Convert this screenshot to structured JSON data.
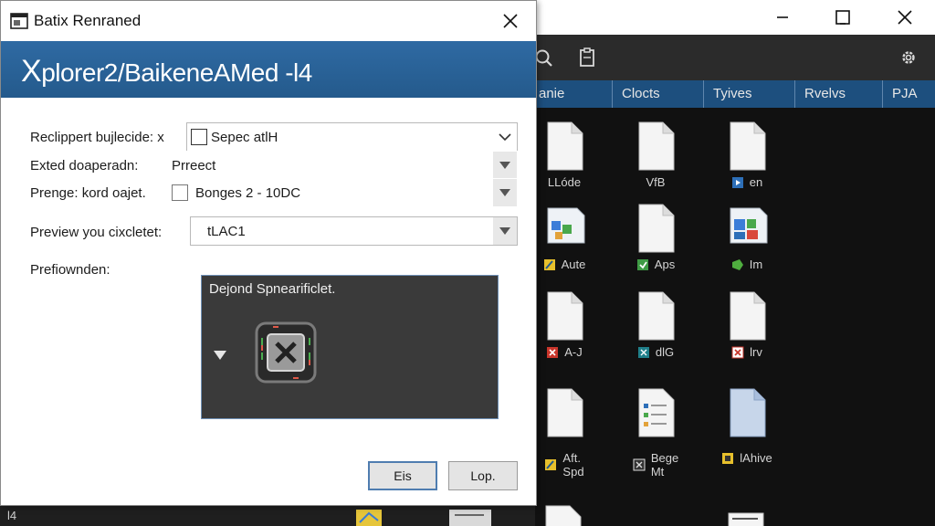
{
  "dialog": {
    "title": "Batix Renraned",
    "banner": {
      "prefix": "X",
      "rest": "plorer2/BaikeneAMed -l4"
    },
    "fields": [
      {
        "label": "Reclippert bujlecide: x",
        "value": "Sepec atlH",
        "checkbox": true,
        "control": "dropdown"
      },
      {
        "label": "Exted doaperadn:",
        "value": "Prreect",
        "checkbox": false,
        "control": "dropdown"
      },
      {
        "label": "Prenge: kord oajet.",
        "value": "Bonges 2 - 10DC",
        "checkbox": true,
        "control": "dropdown"
      },
      {
        "label": "Preview you cixcletet:",
        "value": "tLAC1",
        "checkbox": false,
        "control": "dropdown"
      }
    ],
    "preview": {
      "label": "Prefiownden:",
      "pane_title": "Dejond Spnearificlet."
    },
    "buttons": {
      "ok": "Eis",
      "cancel": "Lop."
    }
  },
  "explorer": {
    "window_controls": [
      "minimize-icon",
      "maximize-icon",
      "close-icon"
    ],
    "toolbar_icons": [
      "search-icon",
      "clipboard-icon",
      "gear-icon"
    ],
    "columns": [
      "anie",
      "Clocts",
      "Tyives",
      "Rvelvs",
      "PJA"
    ],
    "files": [
      {
        "label": "LLóde",
        "icon": "document",
        "badge": ""
      },
      {
        "label": "VfB",
        "icon": "document",
        "badge": ""
      },
      {
        "label": "en",
        "icon": "document",
        "badge": "blue"
      },
      {
        "label": "Aute",
        "icon": "media",
        "badge": "yellow"
      },
      {
        "label": "Aps",
        "icon": "document",
        "badge": "green"
      },
      {
        "label": "Im",
        "icon": "media",
        "badge": "green"
      },
      {
        "label": "A-J",
        "icon": "document",
        "badge": "red"
      },
      {
        "label": "dlG",
        "icon": "document",
        "badge": "teal"
      },
      {
        "label": "lrv",
        "icon": "document",
        "badge": "red"
      },
      {
        "label": "Aft.\nSpd",
        "icon": "document",
        "badge": "yellow"
      },
      {
        "label": "Bege\nMt",
        "icon": "list",
        "badge": "dark"
      },
      {
        "label": "lAhive",
        "icon": "blue-document",
        "badge": "yellow"
      }
    ],
    "status": "l4"
  },
  "colors": {
    "banner": "#2f6aa3",
    "header_bar": "#1d4f7e",
    "explorer_bg": "#111111",
    "dialog_bg": "#ffffff",
    "preview_bg": "#3a3a3a"
  }
}
